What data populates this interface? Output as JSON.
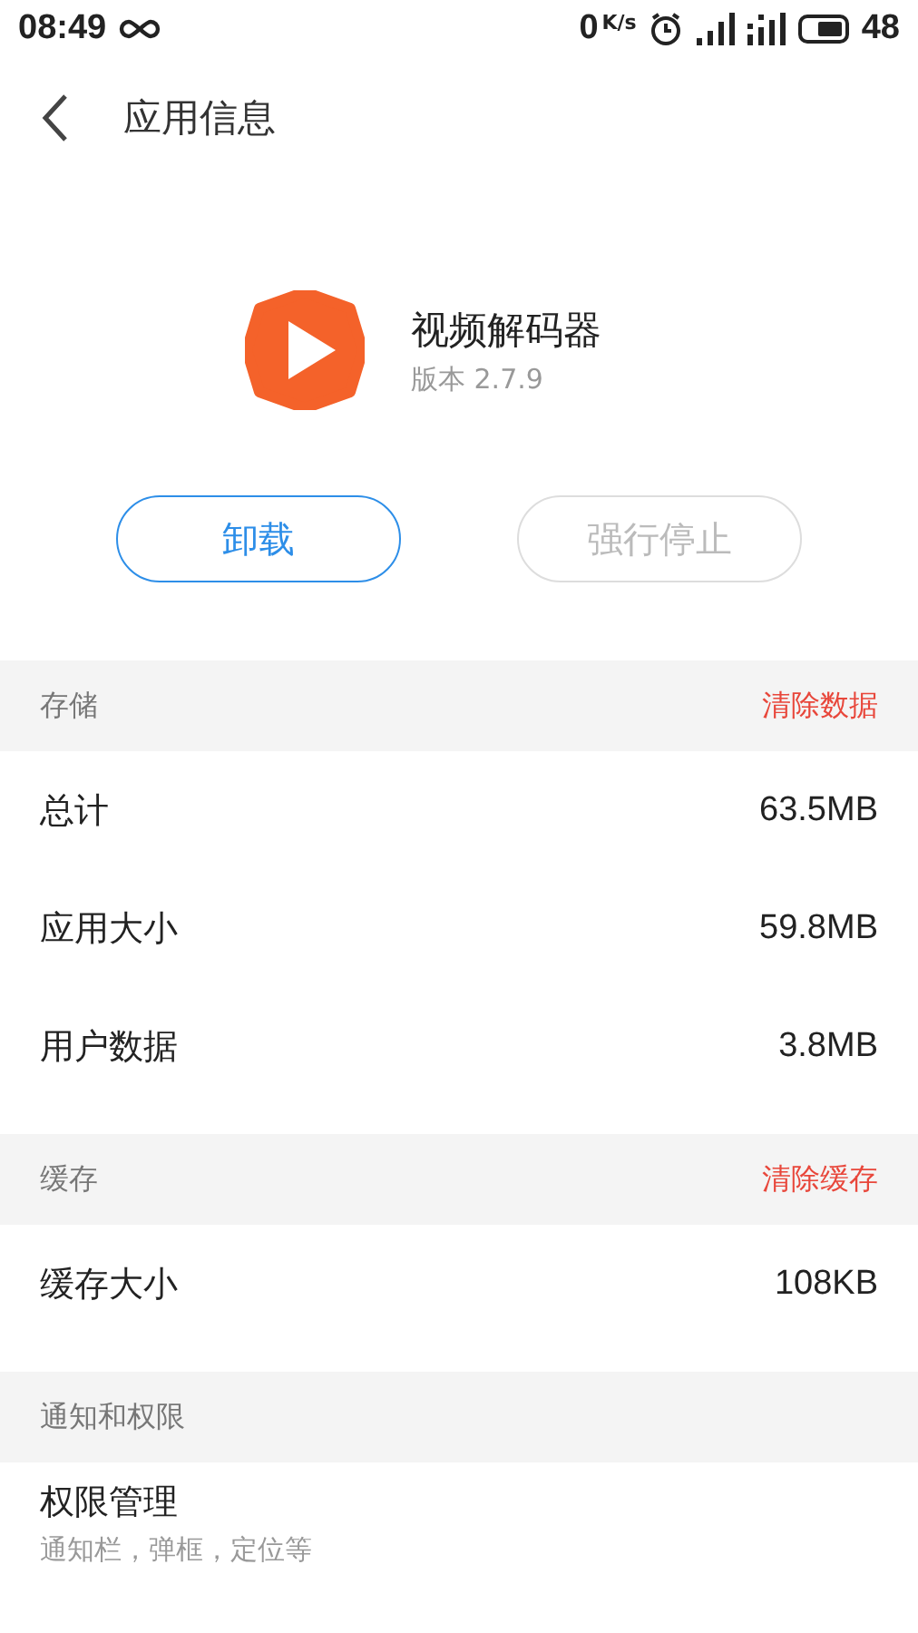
{
  "status_bar": {
    "time": "08:49",
    "speed_value": "0",
    "speed_unit": "K/s",
    "battery": "48"
  },
  "header": {
    "title": "应用信息"
  },
  "app": {
    "name": "视频解码器",
    "version": "版本 2.7.9"
  },
  "buttons": [
    {
      "label": "卸载",
      "disabled": false
    },
    {
      "label": "强行停止",
      "disabled": true
    }
  ],
  "sections": [
    {
      "title": "存储",
      "action": "清除数据",
      "rows": [
        {
          "kind": "value",
          "label": "总计",
          "value": "63.5MB"
        },
        {
          "kind": "value",
          "label": "应用大小",
          "value": "59.8MB"
        },
        {
          "kind": "value",
          "label": "用户数据",
          "value": "3.8MB"
        }
      ]
    },
    {
      "title": "缓存",
      "action": "清除缓存",
      "rows": [
        {
          "kind": "value",
          "label": "缓存大小",
          "value": "108KB"
        }
      ]
    },
    {
      "title": "通知和权限",
      "rows": [
        {
          "kind": "nav",
          "label": "权限管理",
          "subtitle": "通知栏，弹框，定位等"
        }
      ]
    }
  ]
}
